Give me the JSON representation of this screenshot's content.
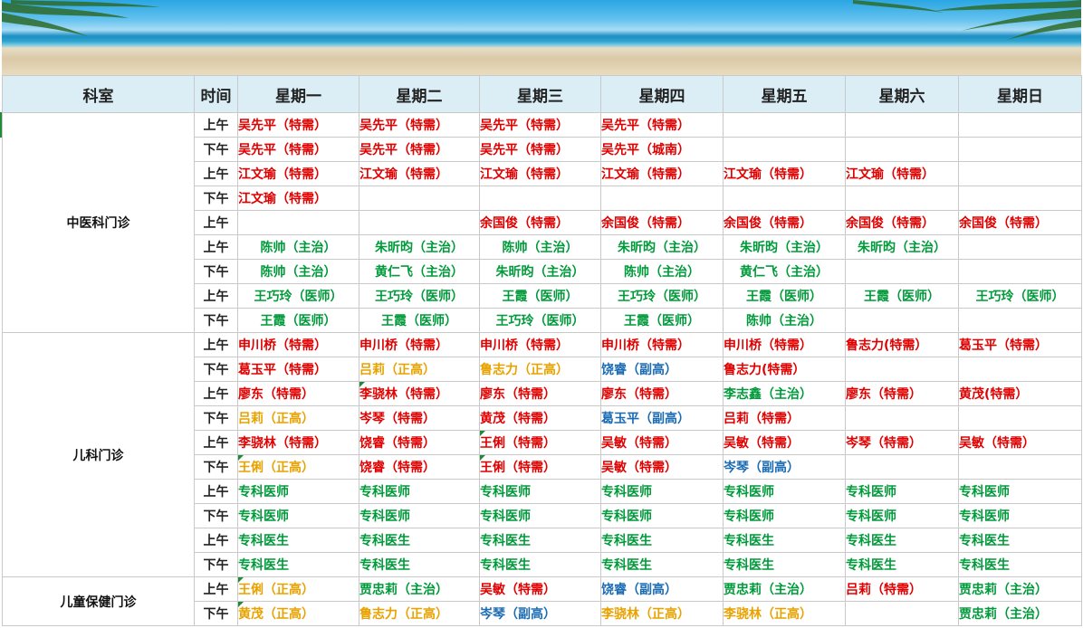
{
  "headers": [
    "科室",
    "时间",
    "星期一",
    "星期二",
    "星期三",
    "星期四",
    "星期五",
    "星期六",
    "星期日"
  ],
  "departments": [
    {
      "name": "中医科门诊",
      "rows": [
        {
          "time": "上午",
          "cells": [
            {
              "t": "吴先平（特需）",
              "c": "red"
            },
            {
              "t": "吴先平（特需）",
              "c": "red"
            },
            {
              "t": "吴先平（特需）",
              "c": "red"
            },
            {
              "t": "吴先平（特需）",
              "c": "red"
            },
            {
              "t": ""
            },
            {
              "t": ""
            },
            {
              "t": ""
            }
          ]
        },
        {
          "time": "下午",
          "cells": [
            {
              "t": "吴先平（特需）",
              "c": "red"
            },
            {
              "t": "吴先平（特需）",
              "c": "red"
            },
            {
              "t": "吴先平（特需）",
              "c": "red"
            },
            {
              "t": "吴先平（城南）",
              "c": "red"
            },
            {
              "t": ""
            },
            {
              "t": ""
            },
            {
              "t": ""
            }
          ]
        },
        {
          "time": "上午",
          "cells": [
            {
              "t": "江文瑜（特需）",
              "c": "red"
            },
            {
              "t": "江文瑜（特需）",
              "c": "red"
            },
            {
              "t": "江文瑜（特需）",
              "c": "red"
            },
            {
              "t": "江文瑜（特需）",
              "c": "red"
            },
            {
              "t": "江文瑜（特需）",
              "c": "red"
            },
            {
              "t": "江文瑜（特需）",
              "c": "red"
            },
            {
              "t": ""
            }
          ]
        },
        {
          "time": "下午",
          "cells": [
            {
              "t": "江文瑜（特需）",
              "c": "red"
            },
            {
              "t": ""
            },
            {
              "t": ""
            },
            {
              "t": ""
            },
            {
              "t": ""
            },
            {
              "t": ""
            },
            {
              "t": ""
            }
          ]
        },
        {
          "time": "上午",
          "cells": [
            {
              "t": ""
            },
            {
              "t": ""
            },
            {
              "t": "余国俊（特需）",
              "c": "red"
            },
            {
              "t": "余国俊（特需）",
              "c": "red"
            },
            {
              "t": "余国俊（特需）",
              "c": "red"
            },
            {
              "t": "余国俊（特需）",
              "c": "red"
            },
            {
              "t": "余国俊（特需）",
              "c": "red"
            }
          ]
        },
        {
          "time": "上午",
          "cells": [
            {
              "t": "陈帅（主治）",
              "c": "green",
              "ctr": 1
            },
            {
              "t": "朱昕昀（主治）",
              "c": "green",
              "ctr": 1
            },
            {
              "t": "陈帅（主治）",
              "c": "green",
              "ctr": 1
            },
            {
              "t": "朱昕昀（主治）",
              "c": "green",
              "ctr": 1
            },
            {
              "t": "朱昕昀（主治）",
              "c": "green",
              "ctr": 1
            },
            {
              "t": "朱昕昀（主治）",
              "c": "green",
              "ctr": 1
            },
            {
              "t": ""
            }
          ]
        },
        {
          "time": "下午",
          "cells": [
            {
              "t": "陈帅（主治）",
              "c": "green",
              "ctr": 1
            },
            {
              "t": "黄仁飞（主治）",
              "c": "green",
              "ctr": 1
            },
            {
              "t": "朱昕昀（主治）",
              "c": "green",
              "ctr": 1
            },
            {
              "t": "陈帅（主治）",
              "c": "green",
              "ctr": 1
            },
            {
              "t": "黄仁飞（主治）",
              "c": "green",
              "ctr": 1
            },
            {
              "t": ""
            },
            {
              "t": ""
            }
          ]
        },
        {
          "time": "上午",
          "cells": [
            {
              "t": "王巧玲（医师）",
              "c": "green",
              "ctr": 1
            },
            {
              "t": "王巧玲（医师）",
              "c": "green",
              "ctr": 1
            },
            {
              "t": "王霞（医师）",
              "c": "green",
              "ctr": 1
            },
            {
              "t": "王巧玲（医师）",
              "c": "green",
              "ctr": 1
            },
            {
              "t": "王霞（医师）",
              "c": "green",
              "ctr": 1
            },
            {
              "t": "王霞（医师）",
              "c": "green",
              "ctr": 1
            },
            {
              "t": "王巧玲（医师）",
              "c": "green",
              "ctr": 1
            }
          ]
        },
        {
          "time": "下午",
          "cells": [
            {
              "t": "王霞（医师）",
              "c": "green",
              "ctr": 1
            },
            {
              "t": "王霞（医师）",
              "c": "green",
              "ctr": 1
            },
            {
              "t": "王巧玲（医师）",
              "c": "green",
              "ctr": 1
            },
            {
              "t": "王霞（医师）",
              "c": "green",
              "ctr": 1
            },
            {
              "t": "陈帅（主治）",
              "c": "green",
              "ctr": 1
            },
            {
              "t": ""
            },
            {
              "t": ""
            }
          ]
        }
      ]
    },
    {
      "name": "儿科门诊",
      "rows": [
        {
          "time": "上午",
          "cells": [
            {
              "t": "申川桥（特需）",
              "c": "red"
            },
            {
              "t": "申川桥（特需）",
              "c": "red"
            },
            {
              "t": "申川桥（特需）",
              "c": "red"
            },
            {
              "t": "申川桥（特需）",
              "c": "red"
            },
            {
              "t": "申川桥（特需）",
              "c": "red"
            },
            {
              "t": "鲁志力(特需）",
              "c": "red"
            },
            {
              "t": "葛玉平（特需）",
              "c": "red"
            }
          ]
        },
        {
          "time": "下午",
          "cells": [
            {
              "t": "葛玉平（特需）",
              "c": "red"
            },
            {
              "t": "吕莉（正高）",
              "c": "gold"
            },
            {
              "t": "鲁志力（正高）",
              "c": "gold"
            },
            {
              "t": "饶睿（副高）",
              "c": "blue"
            },
            {
              "t": "鲁志力(特需）",
              "c": "red"
            },
            {
              "t": ""
            },
            {
              "t": ""
            }
          ]
        },
        {
          "time": "上午",
          "cells": [
            {
              "t": "廖东（特需）",
              "c": "red"
            },
            {
              "t": "李骁林（特需）",
              "c": "red",
              "tri": 1
            },
            {
              "t": "廖东（特需）",
              "c": "red"
            },
            {
              "t": "廖东（特需）",
              "c": "red"
            },
            {
              "t": "李志鑫（主治）",
              "c": "green"
            },
            {
              "t": "廖东（特需）",
              "c": "red"
            },
            {
              "t": "黄茂(特需）",
              "c": "red"
            }
          ]
        },
        {
          "time": "下午",
          "cells": [
            {
              "t": "吕莉（正高）",
              "c": "gold"
            },
            {
              "t": "岑琴（特需）",
              "c": "red"
            },
            {
              "t": "黄茂（特需）",
              "c": "red"
            },
            {
              "t": "葛玉平（副高）",
              "c": "blue"
            },
            {
              "t": "吕莉（特需）",
              "c": "red"
            },
            {
              "t": ""
            },
            {
              "t": ""
            }
          ]
        },
        {
          "time": "上午",
          "cells": [
            {
              "t": "李骁林（特需）",
              "c": "red"
            },
            {
              "t": "饶睿（特需）",
              "c": "red"
            },
            {
              "t": "王俐（特需）",
              "c": "red",
              "tri": 1
            },
            {
              "t": "吴敏（特需）",
              "c": "red"
            },
            {
              "t": "吴敏（特需）",
              "c": "red"
            },
            {
              "t": "岑琴（特需）",
              "c": "red"
            },
            {
              "t": "吴敏（特需）",
              "c": "red"
            }
          ]
        },
        {
          "time": "下午",
          "cells": [
            {
              "t": "王俐（正高）",
              "c": "gold",
              "tri": 1
            },
            {
              "t": "饶睿（特需）",
              "c": "red"
            },
            {
              "t": "王俐（特需）",
              "c": "red",
              "tri": 1
            },
            {
              "t": "吴敏（特需）",
              "c": "red"
            },
            {
              "t": "岑琴（副高）",
              "c": "blue"
            },
            {
              "t": ""
            },
            {
              "t": ""
            }
          ]
        },
        {
          "time": "上午",
          "cells": [
            {
              "t": "专科医师",
              "c": "green"
            },
            {
              "t": "专科医师",
              "c": "green"
            },
            {
              "t": "专科医师",
              "c": "green"
            },
            {
              "t": "专科医师",
              "c": "green"
            },
            {
              "t": "专科医师",
              "c": "green"
            },
            {
              "t": "专科医师",
              "c": "green"
            },
            {
              "t": "专科医师",
              "c": "green"
            }
          ]
        },
        {
          "time": "下午",
          "cells": [
            {
              "t": "专科医师",
              "c": "green"
            },
            {
              "t": "专科医师",
              "c": "green"
            },
            {
              "t": "专科医师",
              "c": "green"
            },
            {
              "t": "专科医师",
              "c": "green"
            },
            {
              "t": "专科医师",
              "c": "green"
            },
            {
              "t": "专科医师",
              "c": "green"
            },
            {
              "t": "专科医师",
              "c": "green"
            }
          ]
        },
        {
          "time": "上午",
          "cells": [
            {
              "t": "专科医生",
              "c": "green"
            },
            {
              "t": "专科医生",
              "c": "green"
            },
            {
              "t": "专科医生",
              "c": "green"
            },
            {
              "t": "专科医生",
              "c": "green"
            },
            {
              "t": "专科医生",
              "c": "green"
            },
            {
              "t": "专科医生",
              "c": "green"
            },
            {
              "t": "专科医生",
              "c": "green"
            }
          ]
        },
        {
          "time": "下午",
          "cells": [
            {
              "t": "专科医生",
              "c": "green"
            },
            {
              "t": "专科医生",
              "c": "green"
            },
            {
              "t": "专科医生",
              "c": "green"
            },
            {
              "t": "专科医生",
              "c": "green"
            },
            {
              "t": "专科医生",
              "c": "green"
            },
            {
              "t": "专科医生",
              "c": "green"
            },
            {
              "t": "专科医生",
              "c": "green"
            }
          ]
        }
      ]
    },
    {
      "name": "儿童保健门诊",
      "rows": [
        {
          "time": "上午",
          "cells": [
            {
              "t": "王俐（正高）",
              "c": "gold",
              "tri": 1
            },
            {
              "t": "贾忠莉（主治）",
              "c": "green"
            },
            {
              "t": "吴敏（特需）",
              "c": "red"
            },
            {
              "t": "饶睿（副高）",
              "c": "blue"
            },
            {
              "t": "贾忠莉（主治）",
              "c": "green"
            },
            {
              "t": "吕莉（特需）",
              "c": "red"
            },
            {
              "t": "贾忠莉（主治）",
              "c": "green"
            }
          ]
        },
        {
          "time": "下午",
          "cells": [
            {
              "t": "黄茂（正高）",
              "c": "gold",
              "tri": 1
            },
            {
              "t": "鲁志力（正高）",
              "c": "gold"
            },
            {
              "t": "岑琴（副高）",
              "c": "blue"
            },
            {
              "t": "李骁林（正高）",
              "c": "gold"
            },
            {
              "t": "李骁林（正高）",
              "c": "gold"
            },
            {
              "t": ""
            },
            {
              "t": "贾忠莉（主治）",
              "c": "green"
            }
          ]
        }
      ]
    }
  ]
}
